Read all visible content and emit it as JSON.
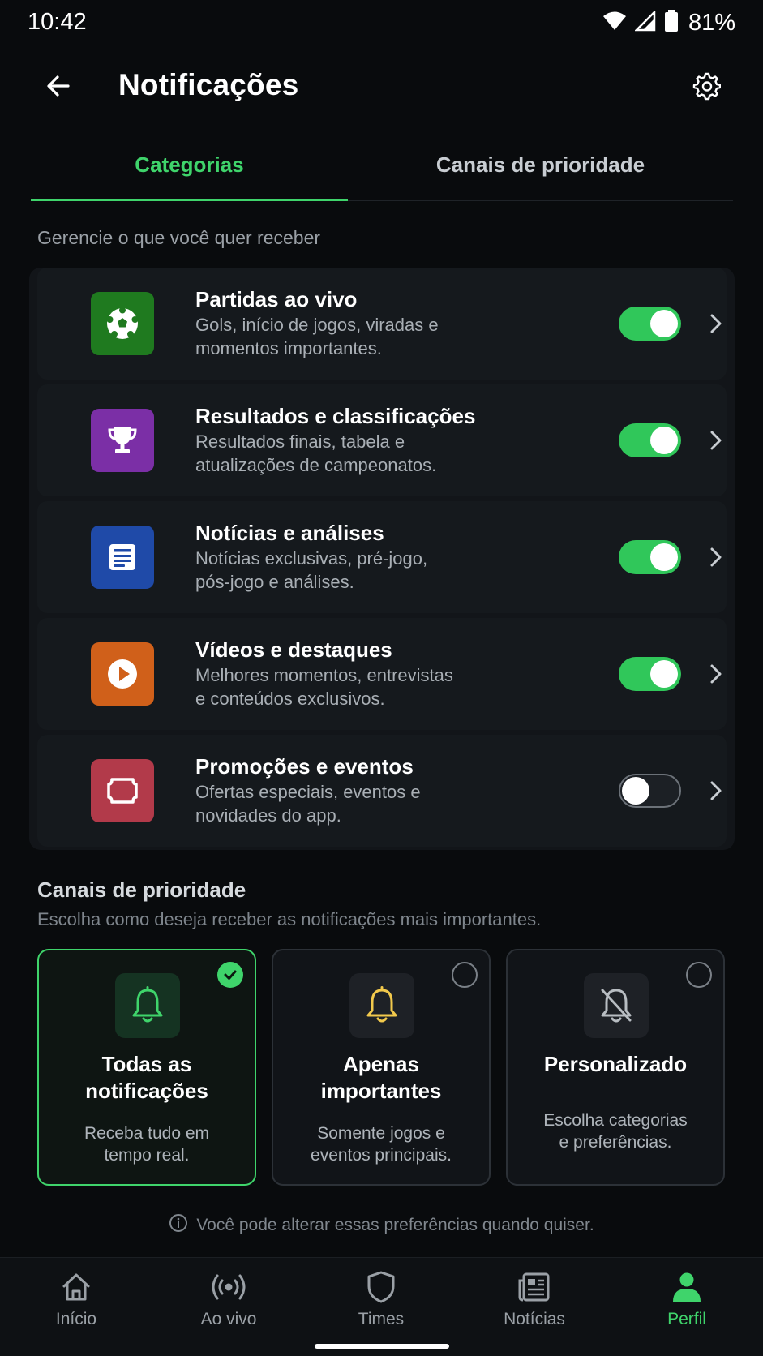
{
  "status_bar": {
    "time": "10:42",
    "battery": "81%"
  },
  "app_bar": {
    "title": "Notificações",
    "back_icon": "arrow-left-icon",
    "settings_icon": "gear-icon"
  },
  "tabs": [
    {
      "label": "Categorias",
      "active": true
    },
    {
      "label": "Canais de prioridade",
      "active": false
    }
  ],
  "section_hint": "Gerencie o que você quer receber",
  "categories": [
    {
      "icon": "soccer-ball-icon",
      "icon_color": "#1f7a1f",
      "title": "Partidas ao vivo",
      "desc_line1": "Gols, início de jogos, viradas e",
      "desc_line2": "momentos importantes.",
      "enabled": true
    },
    {
      "icon": "trophy-icon",
      "icon_color": "#7b2fa6",
      "title": "Resultados e classificações",
      "desc_line1": "Resultados finais, tabela e",
      "desc_line2": "atualizações de campeonatos.",
      "enabled": true
    },
    {
      "icon": "newspaper-icon",
      "icon_color": "#1f4aa8",
      "title": "Notícias e análises",
      "desc_line1": "Notícias exclusivas, pré-jogo,",
      "desc_line2": "pós-jogo e análises.",
      "enabled": true
    },
    {
      "icon": "play-icon",
      "icon_color": "#d0601a",
      "title": "Vídeos e destaques",
      "desc_line1": "Melhores momentos, entrevistas",
      "desc_line2": "e conteúdos exclusivos.",
      "enabled": true
    },
    {
      "icon": "ticket-icon",
      "icon_color": "#b23a4a",
      "title": "Promoções e eventos",
      "desc_line1": "Ofertas especiais, eventos e",
      "desc_line2": "novidades do app.",
      "enabled": false
    }
  ],
  "priority": {
    "title": "Canais de prioridade",
    "subtitle": "Escolha como deseja receber as notificações mais importantes.",
    "options": [
      {
        "title_line1": "Todas as",
        "title_line2": "notificações",
        "desc_line1": "Receba tudo em",
        "desc_line2": "tempo real.",
        "icon": "bell-icon",
        "selected": true
      },
      {
        "title_line1": "Apenas",
        "title_line2": "importantes",
        "desc_line1": "Somente jogos e",
        "desc_line2": "eventos principais.",
        "icon": "bell-icon",
        "selected": false
      },
      {
        "title_line1": "Personalizado",
        "title_line2": "",
        "desc_line1": "Escolha categorias",
        "desc_line2": "e preferências.",
        "icon": "bell-off-icon",
        "selected": false
      }
    ]
  },
  "info_note": "Você pode alterar essas preferências quando quiser.",
  "bottom_nav": [
    {
      "label": "Início",
      "icon": "home-icon",
      "active": false
    },
    {
      "label": "Ao vivo",
      "icon": "broadcast-icon",
      "active": false
    },
    {
      "label": "Times",
      "icon": "shield-icon",
      "active": false
    },
    {
      "label": "Notícias",
      "icon": "newspaper-icon",
      "active": false
    },
    {
      "label": "Perfil",
      "icon": "person-icon",
      "active": true
    }
  ],
  "colors": {
    "accent": "#3fd46b",
    "background": "#090b0d",
    "toggle_on": "#30c75a"
  }
}
